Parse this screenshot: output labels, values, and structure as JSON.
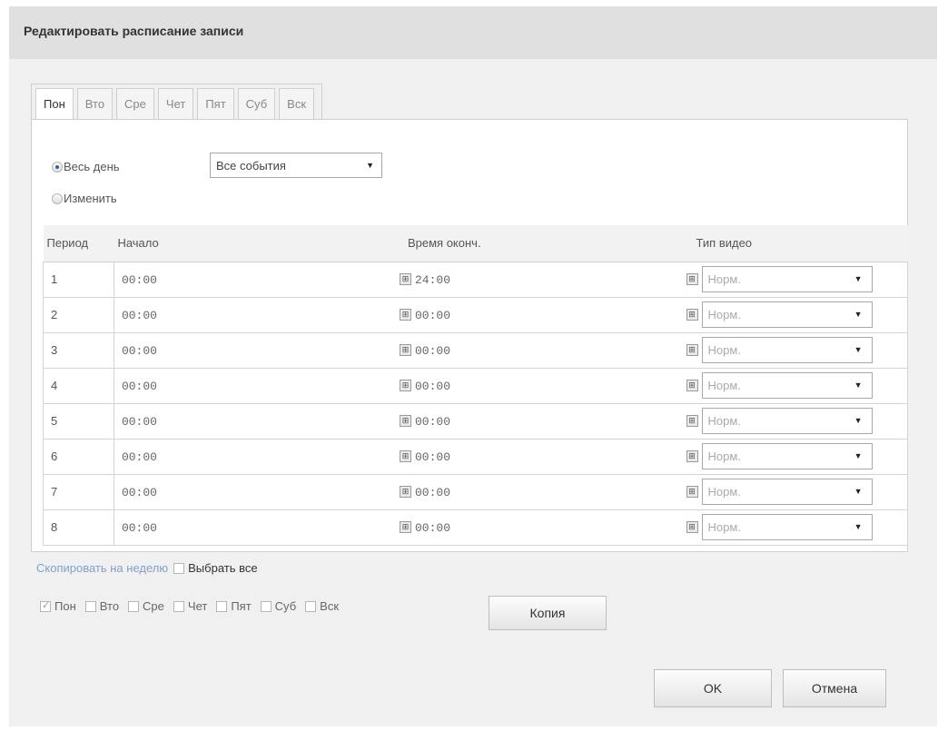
{
  "dialog": {
    "title": "Редактировать расписание записи"
  },
  "tabs": [
    {
      "label": "Пон",
      "active": true
    },
    {
      "label": "Вто",
      "active": false
    },
    {
      "label": "Сре",
      "active": false
    },
    {
      "label": "Чет",
      "active": false
    },
    {
      "label": "Пят",
      "active": false
    },
    {
      "label": "Суб",
      "active": false
    },
    {
      "label": "Вск",
      "active": false
    }
  ],
  "mode": {
    "all_day_label": "Весь день",
    "all_day_checked": true,
    "edit_label": "Изменить",
    "edit_checked": false,
    "event_type_value": "Все события"
  },
  "table": {
    "headers": {
      "period": "Период",
      "start": "Начало",
      "end": "Время оконч.",
      "video_type": "Тип видео"
    },
    "rows": [
      {
        "period": "1",
        "start": "00:00",
        "end": "24:00",
        "type": "Норм."
      },
      {
        "period": "2",
        "start": "00:00",
        "end": "00:00",
        "type": "Норм."
      },
      {
        "period": "3",
        "start": "00:00",
        "end": "00:00",
        "type": "Норм."
      },
      {
        "period": "4",
        "start": "00:00",
        "end": "00:00",
        "type": "Норм."
      },
      {
        "period": "5",
        "start": "00:00",
        "end": "00:00",
        "type": "Норм."
      },
      {
        "period": "6",
        "start": "00:00",
        "end": "00:00",
        "type": "Норм."
      },
      {
        "period": "7",
        "start": "00:00",
        "end": "00:00",
        "type": "Норм."
      },
      {
        "period": "8",
        "start": "00:00",
        "end": "00:00",
        "type": "Норм."
      }
    ]
  },
  "copy": {
    "link_label": "Скопировать на неделю",
    "select_all_label": "Выбрать все",
    "days": [
      {
        "label": "Пон",
        "checked": true
      },
      {
        "label": "Вто",
        "checked": false
      },
      {
        "label": "Сре",
        "checked": false
      },
      {
        "label": "Чет",
        "checked": false
      },
      {
        "label": "Пят",
        "checked": false
      },
      {
        "label": "Суб",
        "checked": false
      },
      {
        "label": "Вск",
        "checked": false
      }
    ],
    "copy_button": "Копия"
  },
  "buttons": {
    "ok": "OK",
    "cancel": "Отмена"
  },
  "icons": {
    "select_arrow": "▼",
    "clock": "⊞"
  }
}
